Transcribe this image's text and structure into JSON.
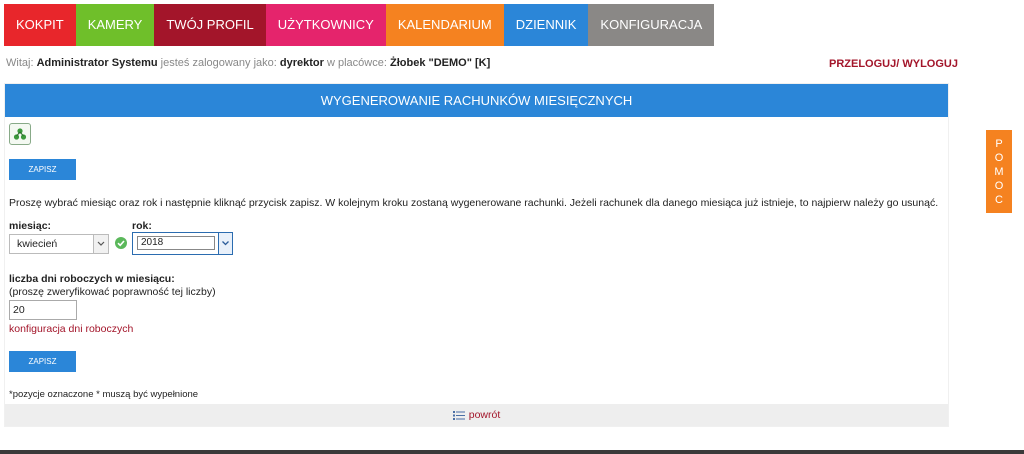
{
  "nav": {
    "tabs": [
      {
        "label": "KOKPIT",
        "color": "#e8262b"
      },
      {
        "label": "KAMERY",
        "color": "#6fbf2a"
      },
      {
        "label": "TWÓJ PROFIL",
        "color": "#a3152a"
      },
      {
        "label": "UŻYTKOWNICY",
        "color": "#e5246c"
      },
      {
        "label": "KALENDARIUM",
        "color": "#f58220"
      },
      {
        "label": "DZIENNIK",
        "color": "#2b86d8"
      },
      {
        "label": "KONFIGURACJA",
        "color": "#8a8886"
      }
    ]
  },
  "welcome": {
    "prefix": "Witaj:",
    "user": "Administrator Systemu",
    "mid": "jesteś zalogowany jako:",
    "role": "dyrektor",
    "mid2": "w placówce:",
    "place": "Żłobek \"DEMO\" [K]"
  },
  "logout": {
    "relog": "PRZELOGUJ",
    "sep": "/",
    "logout": "WYLOGUJ"
  },
  "panel": {
    "title": "WYGENEROWANIE RACHUNKÓW MIESIĘCZNYCH",
    "save_label": "ZAPISZ",
    "instruction": "Proszę wybrać miesiąc oraz rok i następnie kliknąć przycisk zapisz. W kolejnym kroku zostaną wygenerowane rachunki. Jeżeli rachunek dla danego miesiąca już istnieje, to najpierw należy go usunąć.",
    "month_label": "miesiąc:",
    "month_value": "kwiecień",
    "year_label": "rok:",
    "year_value": "2018",
    "days_label": "liczba dni roboczych w miesiącu:",
    "days_sub": "(proszę zweryfikować poprawność tej liczby)",
    "days_value": "20",
    "config_link": "konfiguracja dni roboczych",
    "required_note": "*pozycje oznaczone * muszą być wypełnione",
    "back_label": "powrót"
  },
  "help": {
    "letters": [
      "P",
      "O",
      "M",
      "O",
      "C"
    ]
  },
  "icons": {
    "tree": "tree-icon",
    "check": "check-icon",
    "back": "list-icon"
  }
}
